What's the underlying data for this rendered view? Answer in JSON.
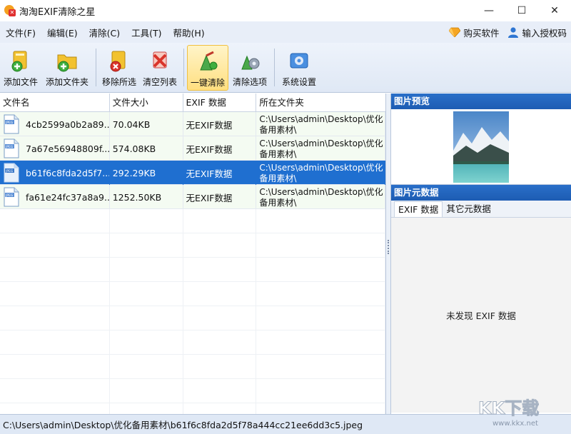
{
  "window": {
    "title": "淘淘EXIF清除之星",
    "minimize": "—",
    "maximize": "☐",
    "close": "✕"
  },
  "menu": {
    "items": [
      "文件(F)",
      "编辑(E)",
      "清除(C)",
      "工具(T)",
      "帮助(H)"
    ],
    "buy": "购买软件",
    "license": "输入授权码"
  },
  "toolbar": {
    "buttons": [
      {
        "label": "添加文件",
        "icon": "add-file-icon"
      },
      {
        "label": "添加文件夹",
        "icon": "add-folder-icon"
      },
      {
        "label": "移除所选",
        "icon": "remove-selected-icon"
      },
      {
        "label": "清空列表",
        "icon": "clear-list-icon"
      },
      {
        "label": "一键清除",
        "icon": "one-click-clean-icon"
      },
      {
        "label": "清除选项",
        "icon": "clean-options-icon"
      },
      {
        "label": "系统设置",
        "icon": "system-settings-icon"
      }
    ],
    "active_index": 4
  },
  "filelist": {
    "columns": [
      "文件名",
      "文件大小",
      "EXIF 数据",
      "所在文件夹"
    ],
    "rows": [
      {
        "name": "4cb2599a0b2a89...",
        "size": "70.04KB",
        "exif": "无EXIF数据",
        "dir": "C:\\Users\\admin\\Desktop\\优化备用素材\\",
        "selected": false
      },
      {
        "name": "7a67e56948809f...",
        "size": "574.08KB",
        "exif": "无EXIF数据",
        "dir": "C:\\Users\\admin\\Desktop\\优化备用素材\\",
        "selected": false
      },
      {
        "name": "b61f6c8fda2d5f7...",
        "size": "292.29KB",
        "exif": "无EXIF数据",
        "dir": "C:\\Users\\admin\\Desktop\\优化备用素材\\",
        "selected": true
      },
      {
        "name": "fa61e24fc37a8a9...",
        "size": "1252.50KB",
        "exif": "无EXIF数据",
        "dir": "C:\\Users\\admin\\Desktop\\优化备用素材\\",
        "selected": false
      }
    ],
    "icon_label": "JPEG"
  },
  "preview": {
    "title": "图片预览"
  },
  "metadata": {
    "title": "图片元数据",
    "tabs": [
      "EXIF 数据",
      "其它元数据"
    ],
    "empty_message": "未发现 EXIF 数据"
  },
  "status": {
    "path": "C:\\Users\\admin\\Desktop\\优化备用素材\\b61f6c8fda2d5f78a444cc21ee6dd3c5.jpeg"
  },
  "watermark": {
    "text": "KK下载",
    "url": "www.kkx.net"
  },
  "colors": {
    "selection": "#1f6fd0",
    "panel_header": "#2a6fc9",
    "toolbar_active": "#ffdf80"
  }
}
